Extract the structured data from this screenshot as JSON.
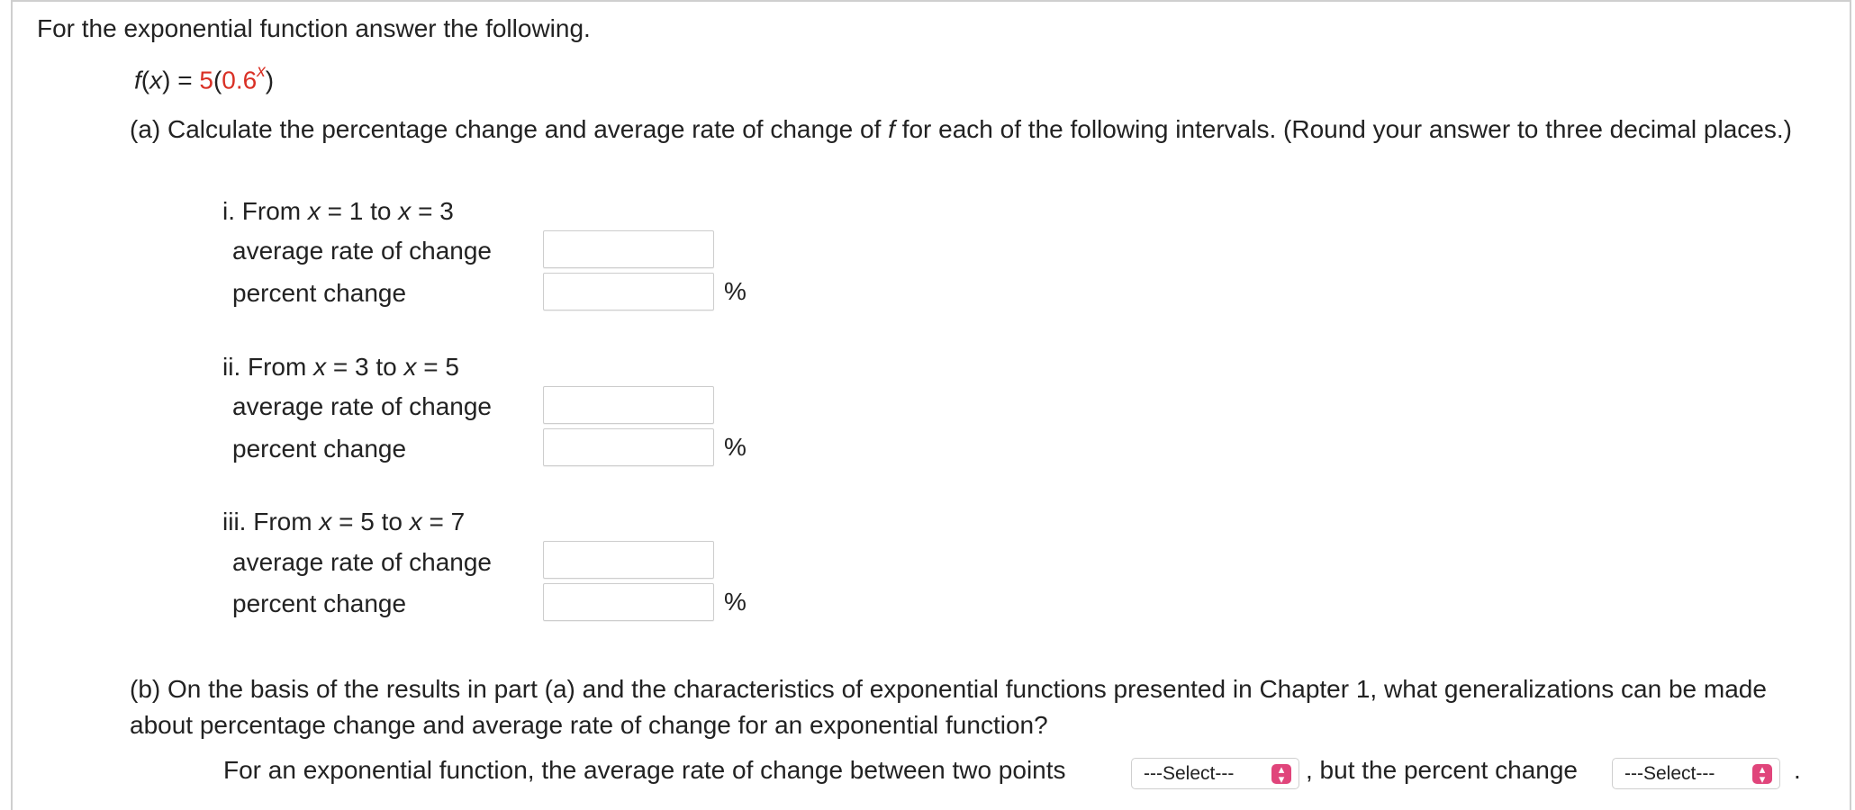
{
  "intro": "For the exponential function answer the following.",
  "function": {
    "name": "f",
    "var": "x",
    "eq": " = ",
    "coef": "5",
    "base": "0.6",
    "exponent": "x"
  },
  "part_a": {
    "text_before": "(a) Calculate the percentage change and average rate of change of ",
    "func_name": "f",
    "text_after": " for each of the following intervals. (Round your answer to three decimal places.)"
  },
  "intervals": [
    {
      "label": "i. From ",
      "var1": "x",
      "start": " = 1 ",
      "to": " to ",
      "var2": "x",
      "end": " = 3",
      "rate_label": "average rate of change",
      "percent_label": "percent change",
      "rate_value": "",
      "percent_value": "",
      "unit": "%"
    },
    {
      "label": "ii. From ",
      "var1": "x",
      "start": " = 3 ",
      "to": " to ",
      "var2": "x",
      "end": " = 5",
      "rate_label": "average rate of change",
      "percent_label": "percent change",
      "rate_value": "",
      "percent_value": "",
      "unit": "%"
    },
    {
      "label": "iii. From ",
      "var1": "x",
      "start": " = 5 ",
      "to": " to ",
      "var2": "x",
      "end": " = 7",
      "rate_label": "average rate of change",
      "percent_label": "percent change",
      "rate_value": "",
      "percent_value": "",
      "unit": "%"
    }
  ],
  "part_b": {
    "question": "(b) On the basis of the results in part (a) and the characteristics of exponential functions presented in Chapter 1, what generalizations can be made about percentage change and average rate of change for an exponential function?",
    "sentence_start": "For an exponential function, the average rate of change between two points",
    "select1": "---Select---",
    "sentence_middle": ", but the percent change",
    "select2": "---Select---",
    "sentence_end": "."
  },
  "colors": {
    "accent_red": "#d93025",
    "select_chevron": "#e0457b",
    "border": "#cfcfcf"
  },
  "icons": {
    "select_chevron": "chevron-up-down-icon"
  }
}
